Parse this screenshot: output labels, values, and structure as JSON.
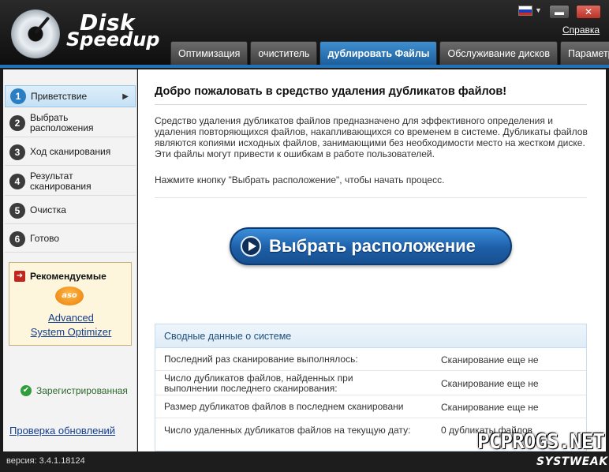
{
  "app": {
    "logo_line1": "Disk",
    "logo_line2": "Speedup",
    "help_link": "Справка",
    "minimize_glyph": "▬",
    "close_glyph": "✕",
    "language_flag": "russian-flag-icon"
  },
  "tabs": [
    {
      "label": "Оптимизация",
      "active": false
    },
    {
      "label": "очиститель",
      "active": false
    },
    {
      "label": "дублировать Файлы",
      "active": true
    },
    {
      "label": "Обслуживание дисков",
      "active": false
    },
    {
      "label": "Параметры",
      "active": false
    }
  ],
  "sidebar": {
    "steps": [
      {
        "num": "1",
        "label": "Приветствие",
        "active": true
      },
      {
        "num": "2",
        "label": "Выбрать расположения",
        "active": false
      },
      {
        "num": "3",
        "label": "Ход сканирования",
        "active": false
      },
      {
        "num": "4",
        "label": "Результат сканирования",
        "active": false
      },
      {
        "num": "5",
        "label": "Очистка",
        "active": false
      },
      {
        "num": "6",
        "label": "Готово",
        "active": false
      }
    ],
    "recommended": {
      "title": "Рекомендуемые",
      "icon_text": "aso",
      "link_line1": "Advanced",
      "link_line2": "System Optimizer"
    },
    "registered": "Зарегистрированная",
    "check_updates": "Проверка обновлений"
  },
  "main": {
    "title": "Добро пожаловать в средство удаления дубликатов файлов!",
    "description": "Средство удаления дубликатов файлов предназначено для эффективного определения и удаления повторяющихся файлов, накапливающихся со временем в системе. Дубликаты файлов являются копиями исходных файлов, занимающими без необходимости место на жестком диске. Эти файлы могут привести к ошибкам в работе пользователей.",
    "hint": "Нажмите кнопку \"Выбрать расположение\", чтобы начать процесс.",
    "select_button": "Выбрать расположение",
    "summary": {
      "title": "Сводные данные о системе",
      "rows": [
        {
          "key": "Последний раз сканирование выполнялось:",
          "value": "Сканирование еще не"
        },
        {
          "key": "Число дубликатов файлов, найденных при выполнении последнего сканирования:",
          "value": "Сканирование еще не"
        },
        {
          "key": "Размер дубликатов файлов в последнем сканировани",
          "value": "Сканирование еще не"
        },
        {
          "key": "Число удаленных дубликатов файлов на текущую дату:",
          "value": "0 дубликаты файлов"
        }
      ]
    }
  },
  "footer": {
    "version": "версия: 3.4.1.18124"
  },
  "watermark": {
    "text": "PCPROGS.NET",
    "brand": "SYSTWEAK"
  },
  "colors": {
    "accent": "#2372b9",
    "active_tab": "#1d5e9c",
    "registered_green": "#2f9d3a"
  }
}
